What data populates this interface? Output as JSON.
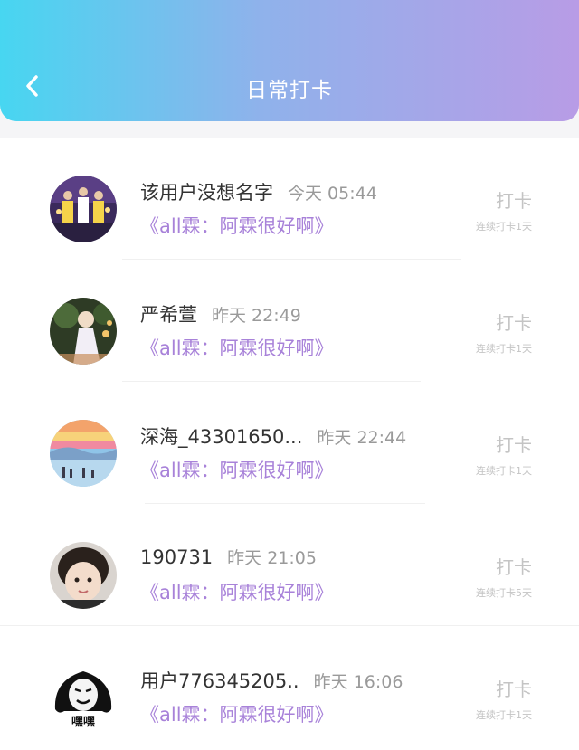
{
  "header": {
    "title": "日常打卡",
    "back_icon": "chevron-left-icon",
    "gradient_start": "#47d6f1",
    "gradient_end": "#b89ce6"
  },
  "book_color": "#a882d9",
  "entries": [
    {
      "name": "该用户没想名字",
      "time": "今天 05:44",
      "book": "《all霖：阿霖很好啊》",
      "action": "打卡",
      "streak": "连续打卡1天",
      "avatar": "group-photo"
    },
    {
      "name": "严希萱",
      "time": "昨天 22:49",
      "book": "《all霖：阿霖很好啊》",
      "action": "打卡",
      "streak": "连续打卡1天",
      "avatar": "person-night-photo"
    },
    {
      "name": "深海_43301650...",
      "time": "昨天 22:44",
      "book": "《all霖：阿霖很好啊》",
      "action": "打卡",
      "streak": "连续打卡1天",
      "avatar": "sunset-landscape"
    },
    {
      "name": "190731",
      "time": "昨天 21:05",
      "book": "《all霖：阿霖很好啊》",
      "action": "打卡",
      "streak": "连续打卡5天",
      "avatar": "child-face"
    },
    {
      "name": "用户776345205..",
      "time": "昨天 16:06",
      "book": "《all霖：阿霖很好啊》",
      "action": "打卡",
      "streak": "连续打卡1天",
      "avatar": "meme-face"
    }
  ],
  "meme_caption": "嘿嘿"
}
